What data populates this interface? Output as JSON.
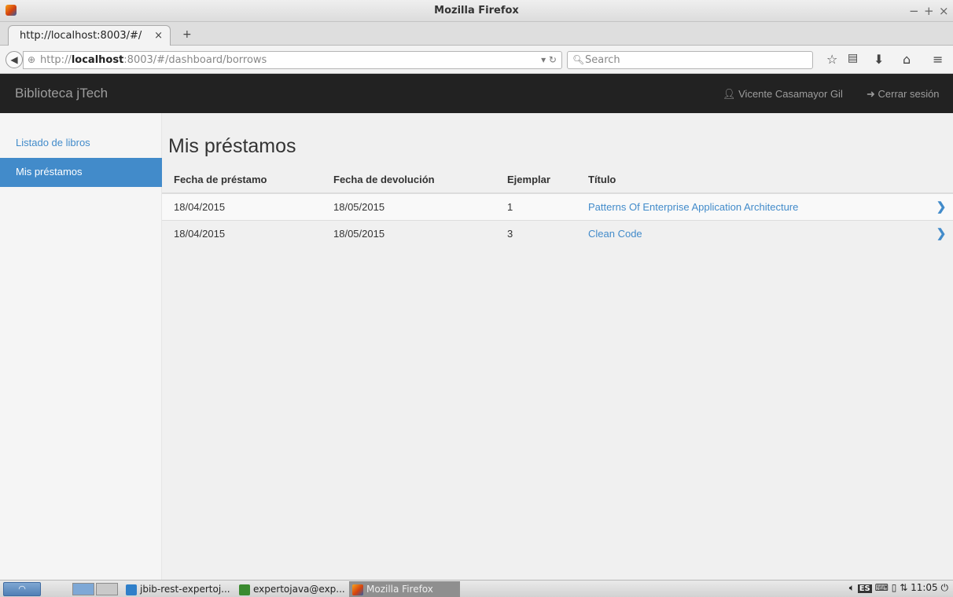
{
  "window": {
    "title": "Mozilla Firefox",
    "controls": [
      "−",
      "+",
      "×"
    ]
  },
  "browser": {
    "tab_title": "http://localhost:8003/#/",
    "tab_close": "×",
    "new_tab": "+",
    "url_prefix": "http://",
    "url_host": "localhost",
    "url_rest": ":8003/#/dashboard/borrows",
    "search_placeholder": "Search",
    "toolbar_icons": [
      "star-icon",
      "reading-list-icon",
      "download-icon",
      "home-icon",
      "menu-icon"
    ]
  },
  "app": {
    "brand": "Biblioteca jTech",
    "user_name": "Vicente Casamayor Gil",
    "logout": "Cerrar sesión",
    "sidebar": {
      "items": [
        {
          "label": "Listado de libros",
          "active": false
        },
        {
          "label": "Mis préstamos",
          "active": true
        }
      ]
    },
    "page_title": "Mis préstamos",
    "table": {
      "headers": [
        "Fecha de préstamo",
        "Fecha de devolución",
        "Ejemplar",
        "Título"
      ],
      "rows": [
        {
          "fecha_prestamo": "18/04/2015",
          "fecha_devolucion": "18/05/2015",
          "ejemplar": "1",
          "titulo": "Patterns Of Enterprise Application Architecture"
        },
        {
          "fecha_prestamo": "18/04/2015",
          "fecha_devolucion": "18/05/2015",
          "ejemplar": "3",
          "titulo": "Clean Code"
        }
      ]
    }
  },
  "taskbar": {
    "tasks": [
      {
        "label": "jbib-rest-expertoj..."
      },
      {
        "label": "expertojava@exp..."
      },
      {
        "label": "Mozilla Firefox"
      }
    ],
    "tray": {
      "keyboard_layout": "ES",
      "clock": "11:05"
    }
  },
  "colors": {
    "navbar_bg": "#222222",
    "link": "#428bca",
    "active_bg": "#428bca"
  }
}
